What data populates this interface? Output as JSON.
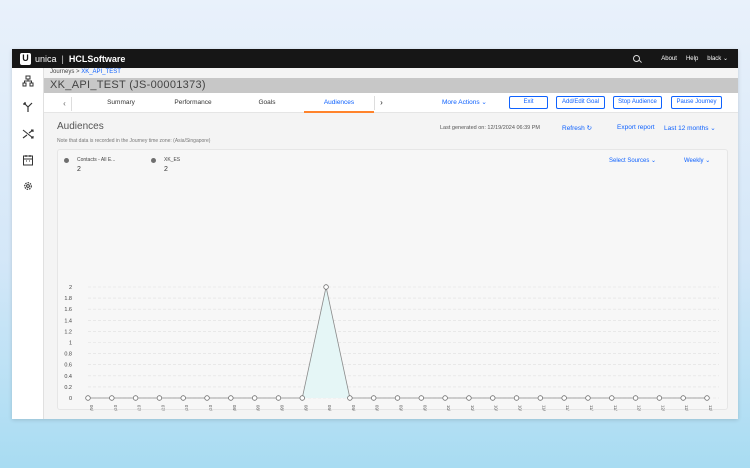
{
  "header": {
    "logo_letter": "U",
    "brand": "unica",
    "brand_separator": "|",
    "company": "HCLSoftware",
    "about": "About",
    "help": "Help",
    "user": "black",
    "user_caret": "⌄"
  },
  "breadcrumb": {
    "root": "Journeys",
    "separator": ">",
    "current": "XK_API_TEST"
  },
  "page": {
    "title": "XK_API_TEST (JS-00001373)"
  },
  "tabs": {
    "prev": "‹",
    "next": "›",
    "items": [
      {
        "label": "Summary",
        "active": false
      },
      {
        "label": "Performance",
        "active": false
      },
      {
        "label": "Goals",
        "active": false
      },
      {
        "label": "Audiences",
        "active": true
      }
    ]
  },
  "toolbar": {
    "more_actions": "More Actions",
    "more_caret": "⌄",
    "exit": "Exit",
    "add_edit_goal": "Add/Edit Goal",
    "stop_audience": "Stop Audience",
    "pause_journey": "Pause Journey"
  },
  "audiences": {
    "title": "Audiences",
    "note": "Note that data is recorded in the Journey time zone: (Asia/Singapore)",
    "generated": "Last generated on: 12/19/2024 06:39 PM",
    "refresh": "Refresh",
    "refresh_icon": "↻",
    "export": "Export report",
    "range": "Last 12 months",
    "range_caret": "⌄",
    "select_sources": "Select Sources",
    "select_caret": "⌄",
    "interval": "Weekly",
    "interval_caret": "⌄",
    "legend": [
      {
        "name": "Contacts - All E...",
        "count": "2",
        "color": "#6f6f6f"
      },
      {
        "name": "XK_ES",
        "count": "2",
        "color": "#6f6f6f"
      }
    ]
  },
  "colors": {
    "accent": "#0f62fe",
    "tab_active_underline": "#ff832b",
    "area_fill": "#e5f6f6",
    "line": "#8a8a8a"
  },
  "chart_data": {
    "type": "area",
    "yticks": [
      "0",
      "0.2",
      "0.4",
      "0.6",
      "0.8",
      "1",
      "1.2",
      "1.4",
      "1.6",
      "1.8",
      "2"
    ],
    "ylim": [
      0,
      2
    ],
    "x_top": [
      "06/23/2024",
      "07/01/2024",
      "07/07/2024",
      "07/14/2024",
      "07/21/2024",
      "07/28/2024",
      "08/04/2024",
      "08/11/2024",
      "08/18/2024",
      "08/25/2024",
      "09/01/2024",
      "09/08/2024",
      "09/15/2024",
      "09/22/2024",
      "09/29/2024",
      "10/06/2024",
      "10/13/2024",
      "10/20/2024",
      "10/27/2024",
      "11/03/2024",
      "11/10/2024",
      "11/17/2024",
      "11/24/2024",
      "12/01/2024",
      "12/08/2024",
      "12/15/2024",
      "12/22/2024"
    ],
    "x_bottom": [
      "06/24/2024",
      "07/01/2024",
      "07/08/2024",
      "07/15/2024",
      "07/22/2024",
      "07/29/2024",
      "08/05/2024",
      "08/12/2024",
      "08/19/2024",
      "08/26/2024",
      "09/02/2024",
      "09/09/2024",
      "09/16/2024",
      "09/23/2024",
      "09/30/2024",
      "10/07/2024",
      "10/14/2024",
      "10/21/2024",
      "10/28/2024",
      "11/04/2024",
      "11/11/2024",
      "11/18/2024",
      "11/25/2024",
      "12/02/2024",
      "12/09/2024",
      "12/16/2024"
    ],
    "values": [
      0,
      0,
      0,
      0,
      0,
      0,
      0,
      0,
      0,
      0,
      2,
      0,
      0,
      0,
      0,
      0,
      0,
      0,
      0,
      0,
      0,
      0,
      0,
      0,
      0,
      0,
      0
    ],
    "grid": true,
    "scrollbar": true
  }
}
